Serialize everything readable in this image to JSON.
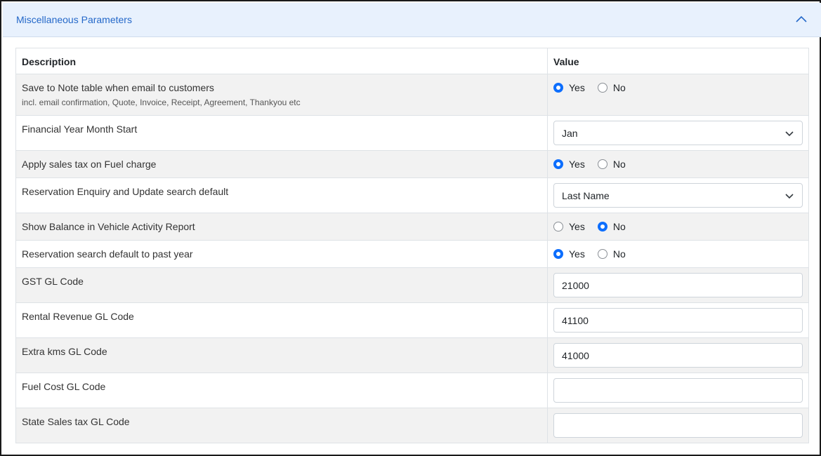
{
  "panel": {
    "title": "Miscellaneous Parameters"
  },
  "table": {
    "headers": {
      "description": "Description",
      "value": "Value"
    },
    "rows": [
      {
        "label": "Save to Note table when email to customers",
        "sub": "incl. email confirmation, Quote, Invoice, Receipt, Agreement, Thankyou etc",
        "type": "radio",
        "selected": "Yes"
      },
      {
        "label": "Financial Year Month Start",
        "type": "select",
        "value": "Jan"
      },
      {
        "label": "Apply sales tax on Fuel charge",
        "type": "radio",
        "selected": "Yes"
      },
      {
        "label": "Reservation Enquiry and Update search default",
        "type": "select",
        "value": "Last Name"
      },
      {
        "label": "Show Balance in Vehicle Activity Report",
        "type": "radio",
        "selected": "No"
      },
      {
        "label": "Reservation search default to past year",
        "type": "radio",
        "selected": "Yes"
      },
      {
        "label": "GST GL Code",
        "type": "text",
        "value": "21000"
      },
      {
        "label": "Rental Revenue GL Code",
        "type": "text",
        "value": "41100"
      },
      {
        "label": "Extra kms GL Code",
        "type": "text",
        "value": "41000"
      },
      {
        "label": "Fuel Cost GL Code",
        "type": "text",
        "value": ""
      },
      {
        "label": "State Sales tax GL Code",
        "type": "text",
        "value": ""
      }
    ]
  },
  "radio_options": {
    "yes": "Yes",
    "no": "No"
  },
  "icons": {
    "collapse": "chevron-up-icon",
    "dropdown": "chevron-down-icon"
  },
  "colors": {
    "accent": "#0d6efd",
    "header_bg": "#e8f1fd",
    "title": "#2468c9",
    "stripe": "#f2f2f2"
  }
}
